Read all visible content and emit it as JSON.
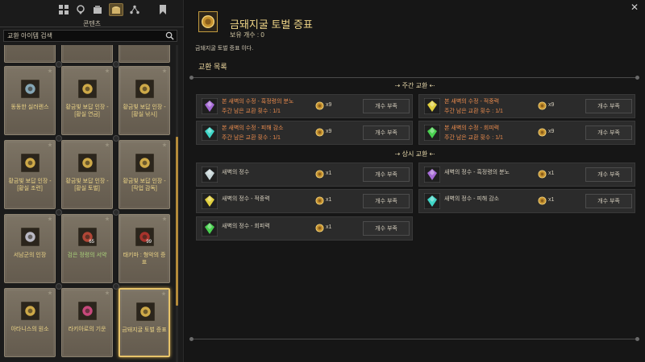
{
  "left": {
    "top_icons": [
      "grid-icon",
      "map-pin-icon",
      "box-icon",
      "chest-icon",
      "share-icon",
      "bookmark-icon"
    ],
    "tab_title": "콘텐츠",
    "search_placeholder": "교환 아이템 검색",
    "cards": [
      {
        "name": "동동한 실러렌스",
        "color": "#8fb5c6",
        "qty": ""
      },
      {
        "name": "황금빛 보답 인장 - [황실 연금]",
        "color": "#e0b84e",
        "qty": ""
      },
      {
        "name": "황금빛 보답 인장 - [황실 낚시]",
        "color": "#e0b84e",
        "qty": ""
      },
      {
        "name": "황금빛 보답 인장 - [황실 조련]",
        "color": "#e0b84e",
        "qty": ""
      },
      {
        "name": "황금빛 보답 인장 - [황실 토벌]",
        "color": "#e0b84e",
        "qty": ""
      },
      {
        "name": "황금빛 보답 인장 - [작업 감독]",
        "color": "#e0b84e",
        "qty": ""
      },
      {
        "name": "서남군의 인장",
        "color": "#c9c9d6",
        "qty": ""
      },
      {
        "name": "검은 정령의 서약",
        "color": "#c04a3a",
        "qty": "65"
      },
      {
        "name": "태키마 : 형악의 증표",
        "color": "#b6352f",
        "qty": "99"
      },
      {
        "name": "아타니스의 원소",
        "color": "#e0b84e",
        "qty": ""
      },
      {
        "name": "라키아로의 기운",
        "color": "#d84d86",
        "qty": ""
      },
      {
        "name": "금돼지굴 토벌 증표",
        "color": "#e0b84e",
        "qty": ""
      }
    ]
  },
  "header": {
    "title": "금돼지굴 토벌 증표",
    "count": "보유 개수 : 0",
    "description": "금돼지굴 토벌 증표 이다.",
    "list_title": "교환 목록"
  },
  "sections": {
    "weekly": "주간 교환",
    "always": "상시 교환"
  },
  "weekly_items": [
    {
      "name": "본 새벽의 수정 - 흑정령의 분노",
      "sub": "주간 남은 교환 횟수 : 1/1",
      "gem": "#a66bd6",
      "cost": "x9",
      "button": "개수 부족"
    },
    {
      "name": "본 새벽의 수정 - 적중력",
      "sub": "주간 남은 교환 횟수 : 1/1",
      "gem": "#e0cf3e",
      "cost": "x9",
      "button": "개수 부족"
    },
    {
      "name": "본 새벽의 수정 - 피해 감소",
      "sub": "주간 남은 교환 횟수 : 1/1",
      "gem": "#3fd6c7",
      "cost": "x9",
      "button": "개수 부족"
    },
    {
      "name": "본 새벽의 수정 - 회피력",
      "sub": "주간 남은 교환 횟수 : 1/1",
      "gem": "#49d04f",
      "cost": "x9",
      "button": "개수 부족"
    }
  ],
  "always_items": [
    {
      "name": "새벽의 정수",
      "gem": "#c8d6d8",
      "cost": "x1",
      "button": "개수 부족"
    },
    {
      "name": "새벽의 정수 - 흑정령의 분노",
      "gem": "#a66bd6",
      "cost": "x1",
      "button": "개수 부족"
    },
    {
      "name": "새벽의 정수 - 적중력",
      "gem": "#e0cf3e",
      "cost": "x1",
      "button": "개수 부족"
    },
    {
      "name": "새벽의 정수 - 피해 감소",
      "gem": "#3fd6c7",
      "cost": "x1",
      "button": "개수 부족"
    },
    {
      "name": "새벽의 정수 - 회피력",
      "gem": "#49d04f",
      "cost": "x1",
      "button": "개수 부족"
    }
  ],
  "colors": {
    "accent": "#e8c46a",
    "orange_text": "#e78a4d",
    "coin": "#d4a140"
  },
  "close_glyph": "✕"
}
